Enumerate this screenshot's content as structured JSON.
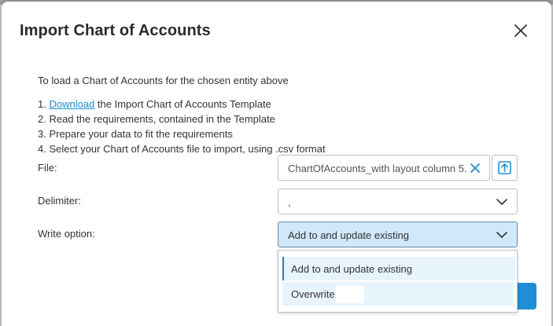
{
  "dialog": {
    "title": "Import Chart of Accounts",
    "intro": "To load a Chart of Accounts for the chosen entity above",
    "steps": {
      "step1_prefix": "1. ",
      "step1_link": "Download",
      "step1_rest": " the Import Chart of Accounts Template",
      "step2": "2. Read the requirements, contained in the Template",
      "step3": "3. Prepare your data to fit the requirements",
      "step4": "4. Select your Chart of Accounts file to import, using .csv format"
    }
  },
  "form": {
    "file_label": "File:",
    "file_value": "ChartOfAccounts_with layout column 5.",
    "delimiter_label": "Delimiter:",
    "delimiter_value": ",",
    "write_label": "Write option:",
    "write_value": "Add to and update existing",
    "write_options": [
      "Add to and update existing",
      "Overwrite"
    ]
  },
  "icons": {
    "close": "close-icon",
    "clear": "clear-x-icon",
    "upload": "upload-icon",
    "chevron": "chevron-down-icon"
  },
  "colors": {
    "accent": "#1e8fd6",
    "link": "#1a8fd0",
    "selected_field_bg": "#cfe8fa",
    "option_bg": "#e8f4fc"
  }
}
